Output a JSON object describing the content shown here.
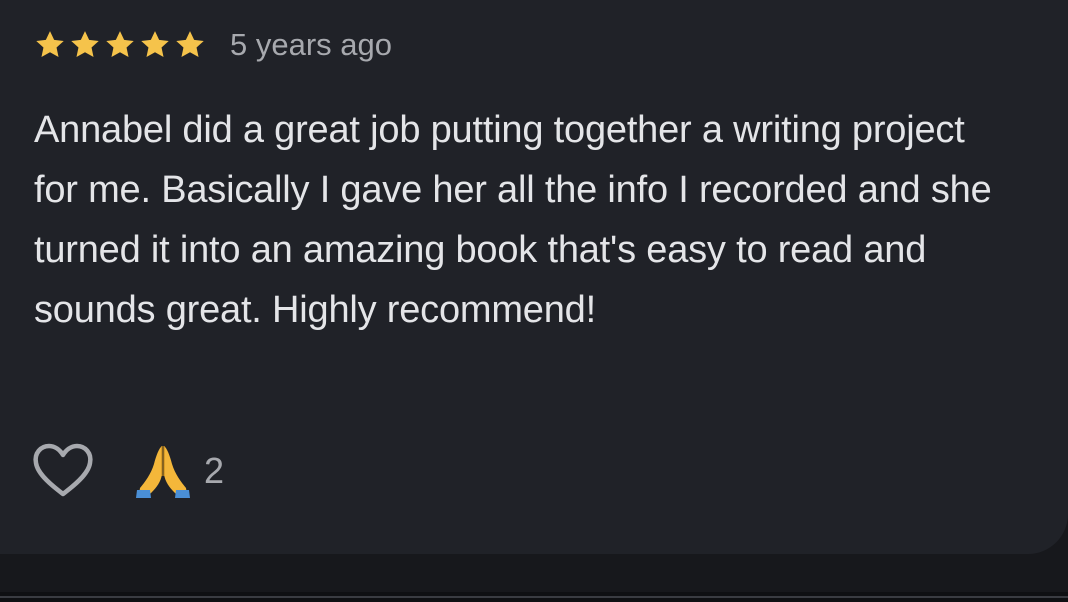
{
  "review": {
    "rating": 5,
    "rating_max": 5,
    "date": "5 years ago",
    "text": "Annabel did a great job putting together a writing project for me. Basically I gave her all the info I recorded and she turned it into an amazing book that's easy to read and sounds great. Highly recommend!",
    "actions": {
      "like_icon": "heart-outline-icon",
      "reaction_icon": "folded-hands-emoji",
      "reaction_count": "2"
    }
  },
  "colors": {
    "background": "#17181c",
    "card": "#202228",
    "star": "#f5c34b",
    "text": "#e4e5e8",
    "muted": "#a7a9ae"
  }
}
